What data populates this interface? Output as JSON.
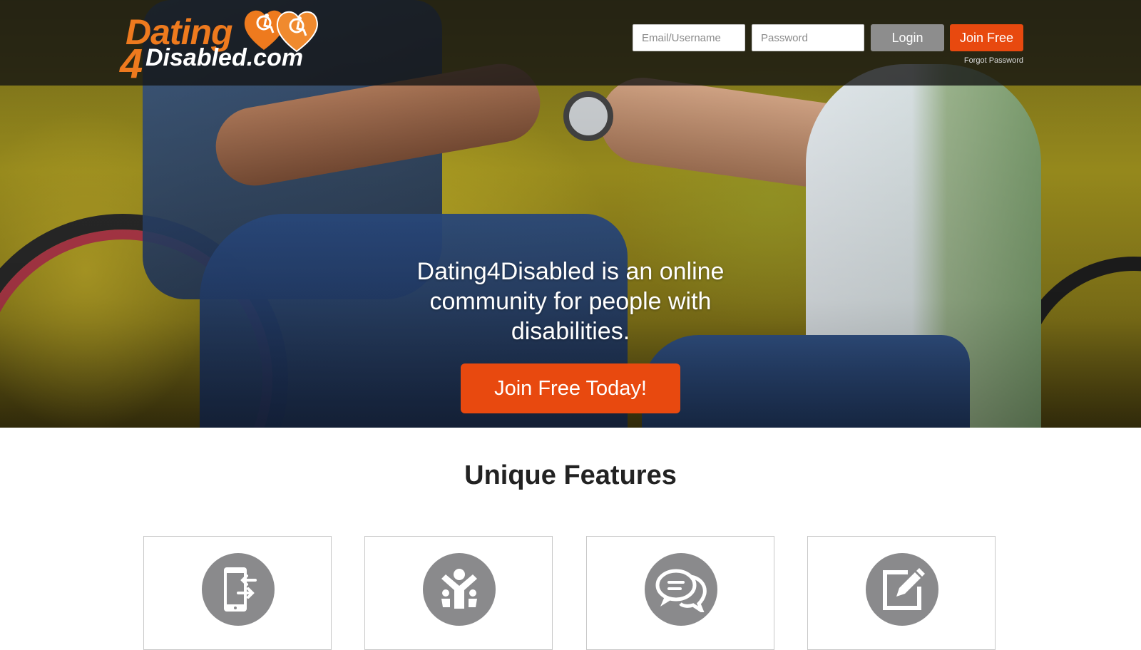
{
  "header": {
    "logo": {
      "line1": "Dating",
      "digit": "4",
      "line2": "Disabled.com"
    },
    "login": {
      "email_placeholder": "Email/Username",
      "password_placeholder": "Password",
      "login_label": "Login",
      "join_label": "Join Free",
      "forgot_label": "Forgot Password"
    }
  },
  "hero": {
    "tagline": "Dating4Disabled is an online community for people with disabilities.",
    "cta_label": "Join Free Today!"
  },
  "features": {
    "title": "Unique Features",
    "cards": [
      {
        "icon": "mobile-transfer-icon"
      },
      {
        "icon": "community-people-icon"
      },
      {
        "icon": "chat-bubbles-icon"
      },
      {
        "icon": "edit-profile-icon"
      }
    ]
  },
  "colors": {
    "accent_orange": "#e8490f",
    "logo_orange": "#ee7a1e",
    "login_gray": "#8d8d8d",
    "icon_gray": "#8a8a8c"
  }
}
